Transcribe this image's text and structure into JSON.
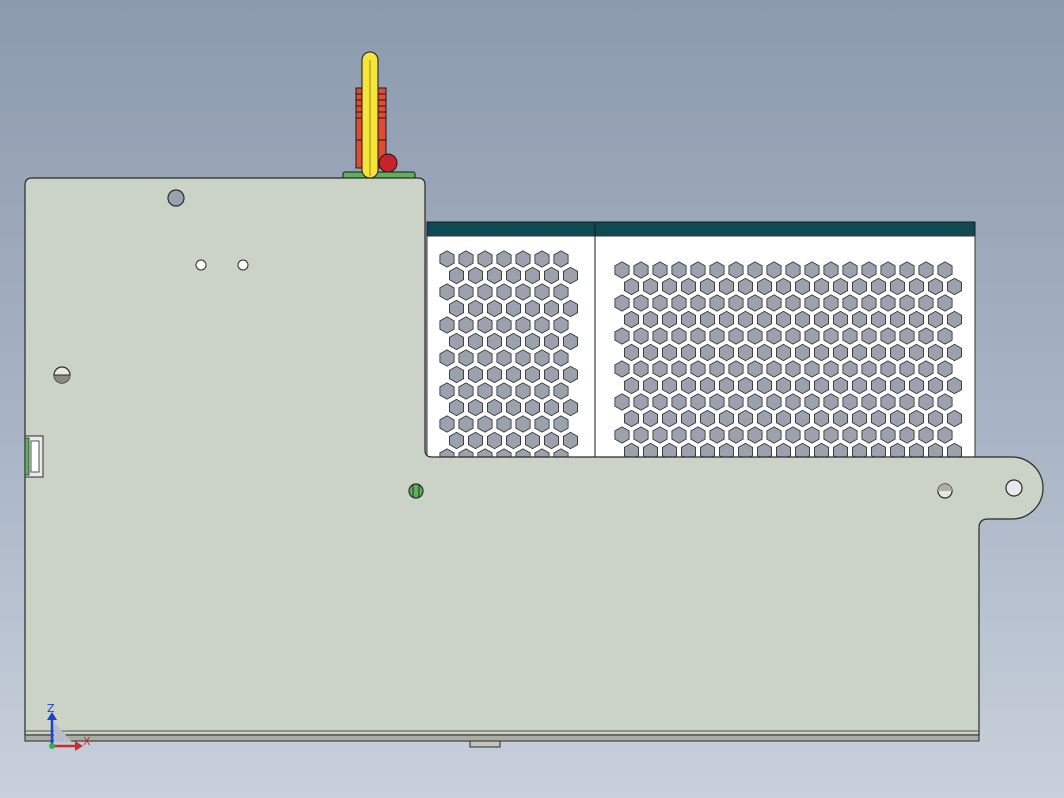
{
  "viewport": {
    "background": [
      "#8c9aae",
      "#c9d0dc"
    ],
    "body_color": "#cbd2c6",
    "outline_color": "#2a2a2a"
  },
  "grille": {
    "header_color": "#0f4a52",
    "panel_color": "#ffffff",
    "hole_color": "#9aa2ae"
  },
  "handle": {
    "shaft_color": "#f5e43a",
    "spring_color": "#e24b33",
    "knob_color": "#c8222a",
    "base_color": "#5fb05a"
  },
  "triad": {
    "z_label": "Z",
    "x_label": "X",
    "z_color": "#1f3fd1",
    "x_color": "#d22a2a"
  }
}
